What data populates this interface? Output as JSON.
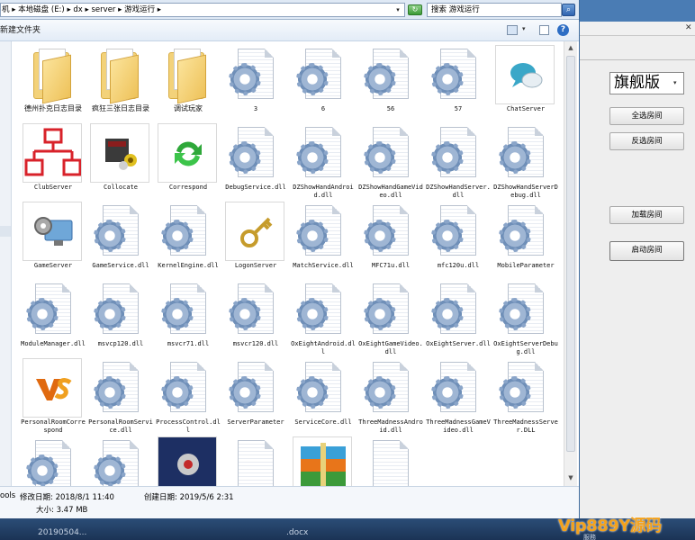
{
  "address_bar": {
    "path": "机 ▸ 本地磁盘 (E:) ▸ dx ▸ server ▸ 游戏运行 ▸",
    "search_value": "搜索 游戏运行"
  },
  "toolbar": {
    "new_folder_label": "新建文件夹"
  },
  "files": [
    {
      "name": "德州扑克日志目录",
      "icon": "folder-icon"
    },
    {
      "name": "疯狂三张日志目录",
      "icon": "folder-icon"
    },
    {
      "name": "调试玩家",
      "icon": "folder-icon"
    },
    {
      "name": "3",
      "icon": "gear-file-icon"
    },
    {
      "name": "6",
      "icon": "gear-file-icon"
    },
    {
      "name": "56",
      "icon": "gear-file-icon"
    },
    {
      "name": "57",
      "icon": "gear-file-icon"
    },
    {
      "name": "ChatServer",
      "icon": "chat-bubble-icon"
    },
    {
      "name": "ClubServer",
      "icon": "network-tree-icon"
    },
    {
      "name": "Collocate",
      "icon": "collocate-app-icon"
    },
    {
      "name": "Correspond",
      "icon": "green-arrows-icon"
    },
    {
      "name": "DebugService.dll",
      "icon": "gear-file-icon"
    },
    {
      "name": "DZShowHandAndroid.dll",
      "icon": "gear-file-icon"
    },
    {
      "name": "DZShowHandGameVideo.dll",
      "icon": "gear-file-icon"
    },
    {
      "name": "DZShowHandServer.dll",
      "icon": "gear-file-icon"
    },
    {
      "name": "DZShowHandServerDebug.dll",
      "icon": "gear-file-icon"
    },
    {
      "name": "GameServer",
      "icon": "monitor-gear-icon"
    },
    {
      "name": "GameService.dll",
      "icon": "gear-file-icon"
    },
    {
      "name": "KernelEngine.dll",
      "icon": "gear-file-icon"
    },
    {
      "name": "LogonServer",
      "icon": "key-icon"
    },
    {
      "name": "MatchService.dll",
      "icon": "gear-file-icon"
    },
    {
      "name": "MFC71u.dll",
      "icon": "gear-file-icon"
    },
    {
      "name": "mfc120u.dll",
      "icon": "gear-file-icon"
    },
    {
      "name": "MobileParameter",
      "icon": "gear-file-icon"
    },
    {
      "name": "ModuleManager.dll",
      "icon": "gear-file-icon"
    },
    {
      "name": "msvcp120.dll",
      "icon": "gear-file-icon"
    },
    {
      "name": "msvcr71.dll",
      "icon": "gear-file-icon"
    },
    {
      "name": "msvcr120.dll",
      "icon": "gear-file-icon"
    },
    {
      "name": "OxEightAndroid.dll",
      "icon": "gear-file-icon"
    },
    {
      "name": "OxEightGameVideo.dll",
      "icon": "gear-file-icon"
    },
    {
      "name": "OxEightServer.dll",
      "icon": "gear-file-icon"
    },
    {
      "name": "OxEightServerDebug.dll",
      "icon": "gear-file-icon"
    },
    {
      "name": "PersonalRoomCorrespond",
      "icon": "vs-logo-icon"
    },
    {
      "name": "PersonalRoomService.dll",
      "icon": "gear-file-icon"
    },
    {
      "name": "ProcessControl.dll",
      "icon": "gear-file-icon"
    },
    {
      "name": "ServerParameter",
      "icon": "gear-file-icon"
    },
    {
      "name": "ServiceCore.dll",
      "icon": "gear-file-icon"
    },
    {
      "name": "ThreeMadnessAndroid.dll",
      "icon": "gear-file-icon"
    },
    {
      "name": "ThreeMadnessGameVideo.dll",
      "icon": "gear-file-icon"
    },
    {
      "name": "ThreeMadnessServer.DLL",
      "icon": "gear-file-icon"
    },
    {
      "name": "",
      "icon": "gear-file-icon"
    },
    {
      "name": "",
      "icon": "gear-file-icon"
    },
    {
      "name": "",
      "icon": "dark-app-icon"
    },
    {
      "name": "",
      "icon": "blank-file-icon"
    },
    {
      "name": "",
      "icon": "archive-icon"
    },
    {
      "name": "",
      "icon": "blank-file-icon"
    }
  ],
  "status_bar": {
    "name_fragment": "ools",
    "modified": "修改日期: 2018/8/1 11:40",
    "created": "创建日期: 2019/5/6 2:31",
    "size": "大小: 3.47 MB"
  },
  "right_panel": {
    "edition": "旗舰版",
    "select_all": "全选房间",
    "invert_select": "反选房间",
    "load_rooms": "加载房间",
    "start_rooms": "启动房间"
  },
  "taskbar": {
    "item_a": "20190504...",
    "item_b": ".docx",
    "item_c": "服務"
  },
  "watermark": "Vip889Y源码",
  "colors": {
    "panel_blue": "#4a7cb4",
    "folder_yellow": "#f3d27a",
    "watermark_orange": "#f4a21c"
  }
}
